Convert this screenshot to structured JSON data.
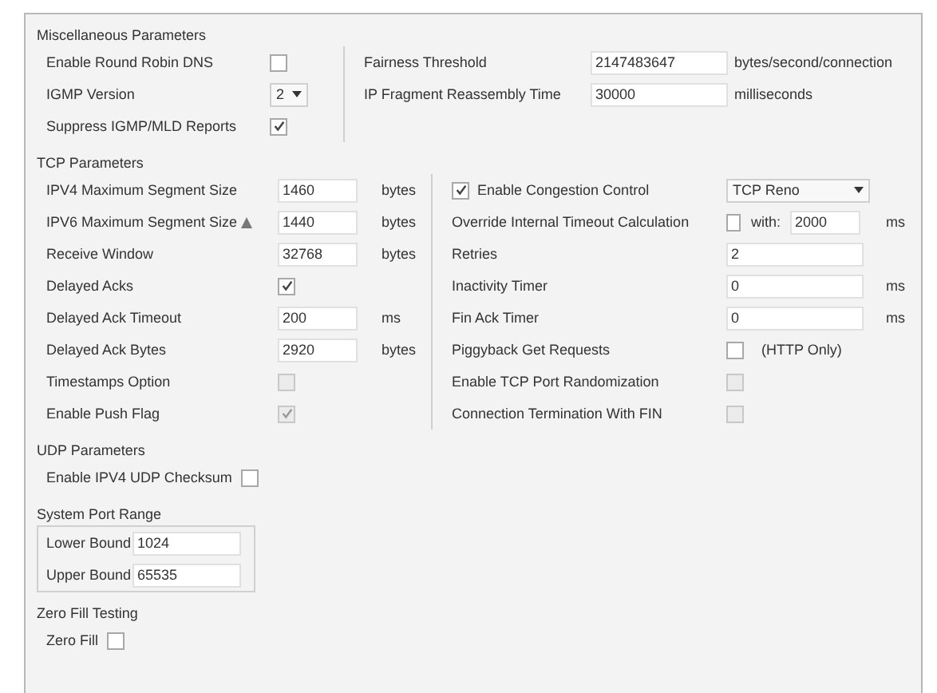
{
  "miscellaneous": {
    "title": "Miscellaneous Parameters",
    "left": [
      {
        "kind": "checkbox",
        "label": "Enable Round Robin DNS",
        "checked": false,
        "disabled": false
      },
      {
        "kind": "select",
        "label": "IGMP Version",
        "value": "2"
      },
      {
        "kind": "checkbox",
        "label": "Suppress IGMP/MLD Reports",
        "checked": true,
        "disabled": false
      }
    ],
    "right": [
      {
        "kind": "field",
        "label": "Fairness Threshold",
        "value": "2147483647",
        "unit": "bytes/second/connection"
      },
      {
        "kind": "field",
        "label": "IP Fragment Reassembly Time",
        "value": "30000",
        "unit": "milliseconds"
      }
    ]
  },
  "tcp": {
    "title": "TCP Parameters",
    "left": [
      {
        "kind": "field",
        "label": "IPV4 Maximum Segment Size",
        "value": "1460",
        "unit": "bytes"
      },
      {
        "kind": "field",
        "label": "IPV6 Maximum Segment Size",
        "warning": true,
        "value": "1440",
        "unit": "bytes"
      },
      {
        "kind": "field",
        "label": "Receive Window",
        "value": "32768",
        "unit": "bytes"
      },
      {
        "kind": "checkbox",
        "label": "Delayed Acks",
        "checked": true,
        "disabled": false
      },
      {
        "kind": "field",
        "label": "Delayed Ack Timeout",
        "value": "200",
        "unit": "ms"
      },
      {
        "kind": "field",
        "label": "Delayed Ack Bytes",
        "value": "2920",
        "unit": "bytes"
      },
      {
        "kind": "checkbox",
        "label": "Timestamps Option",
        "checked": false,
        "disabled": true
      },
      {
        "kind": "checkbox",
        "label": "Enable Push Flag",
        "checked": true,
        "disabled": true
      }
    ],
    "right": [
      {
        "kind": "check-select",
        "label": "Enable Congestion Control",
        "checked": true,
        "value": "TCP Reno"
      },
      {
        "kind": "check-with",
        "label": "Override Internal Timeout Calculation",
        "checked": false,
        "with_label": "with:",
        "value": "2000",
        "unit": "ms"
      },
      {
        "kind": "field",
        "label": "Retries",
        "value": "2"
      },
      {
        "kind": "field",
        "label": "Inactivity Timer",
        "value": "0",
        "unit": "ms"
      },
      {
        "kind": "field",
        "label": "Fin Ack Timer",
        "value": "0",
        "unit": "ms"
      },
      {
        "kind": "checkbox",
        "label": "Piggyback Get Requests",
        "checked": false,
        "disabled": false,
        "note": "(HTTP Only)"
      },
      {
        "kind": "checkbox",
        "label": "Enable TCP Port Randomization",
        "checked": false,
        "disabled": true
      },
      {
        "kind": "checkbox",
        "label": "Connection Termination With FIN",
        "checked": false,
        "disabled": true
      }
    ]
  },
  "udp": {
    "title": "UDP Parameters",
    "rows": [
      {
        "kind": "checkbox",
        "label": "Enable IPV4 UDP Checksum",
        "checked": false,
        "disabled": false
      }
    ]
  },
  "port_range": {
    "title": "System Port Range",
    "rows": [
      {
        "kind": "field",
        "label": "Lower Bound",
        "value": "1024"
      },
      {
        "kind": "field",
        "label": "Upper Bound",
        "value": "65535"
      }
    ]
  },
  "zero_fill": {
    "title": "Zero Fill Testing",
    "rows": [
      {
        "kind": "checkbox",
        "label": "Zero Fill",
        "checked": false,
        "disabled": false
      }
    ]
  }
}
